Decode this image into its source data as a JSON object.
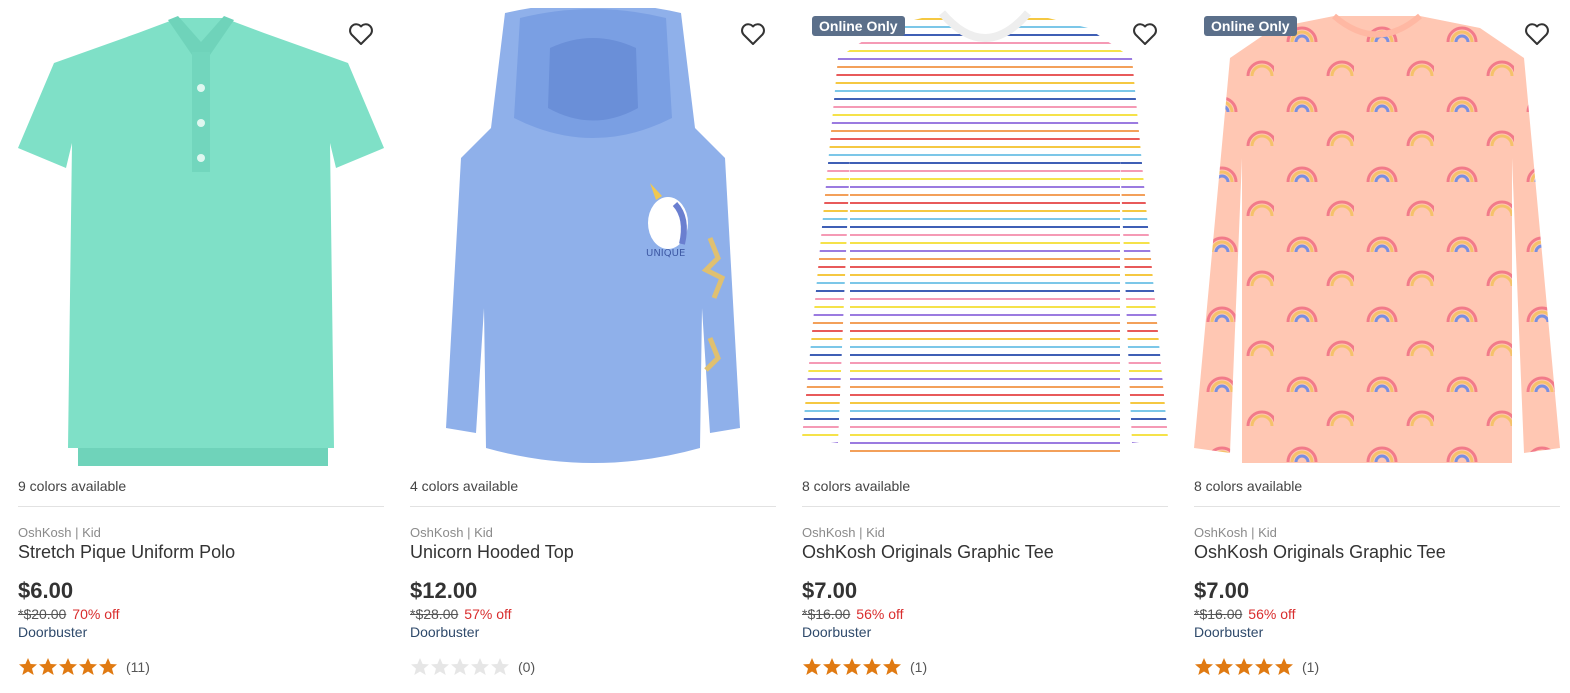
{
  "products": [
    {
      "badge": "",
      "colors": "9 colors available",
      "brand": "OshKosh | Kid",
      "name": "Stretch Pique Uniform Polo",
      "price": "$6.00",
      "was": "*$20.00",
      "off": "70% off",
      "promo": "Doorbuster",
      "rating": 5,
      "count": "(11)",
      "image_color": "#7fe0c7"
    },
    {
      "badge": "",
      "colors": "4 colors available",
      "brand": "OshKosh | Kid",
      "name": "Unicorn Hooded Top",
      "price": "$12.00",
      "was": "*$28.00",
      "off": "57% off",
      "promo": "Doorbuster",
      "rating": 0,
      "count": "(0)",
      "image_color": "#8fb0ea"
    },
    {
      "badge": "Online Only",
      "colors": "8 colors available",
      "brand": "OshKosh | Kid",
      "name": "OshKosh Originals Graphic Tee",
      "price": "$7.00",
      "was": "*$16.00",
      "off": "56% off",
      "promo": "Doorbuster",
      "rating": 5,
      "count": "(1)",
      "image_color": "#ffffff"
    },
    {
      "badge": "Online Only",
      "colors": "8 colors available",
      "brand": "OshKosh | Kid",
      "name": "OshKosh Originals Graphic Tee",
      "price": "$7.00",
      "was": "*$16.00",
      "off": "56% off",
      "promo": "Doorbuster",
      "rating": 5,
      "count": "(1)",
      "image_color": "#ffc7b3"
    }
  ],
  "colors": {
    "star_filled": "#e07a12",
    "star_empty": "#e6e6e6",
    "discount": "#d92d2d",
    "badge_bg": "#5b6f8a"
  }
}
